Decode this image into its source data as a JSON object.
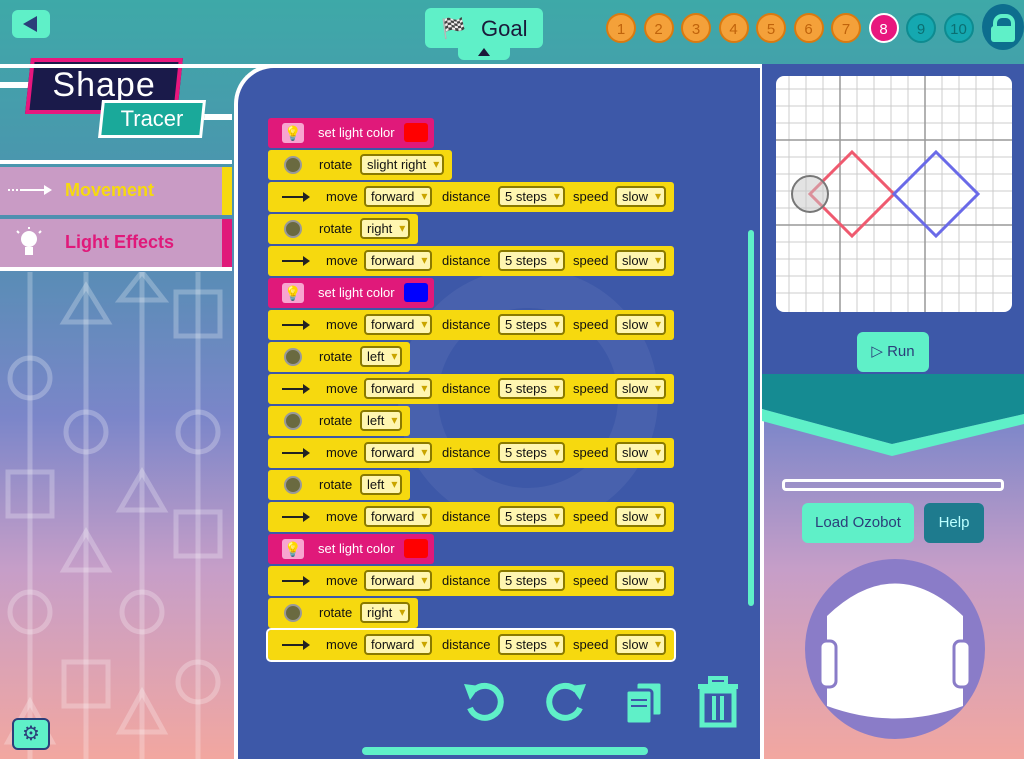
{
  "header": {
    "goal_label": "Goal",
    "levels": [
      {
        "n": "1",
        "state": "done"
      },
      {
        "n": "2",
        "state": "done"
      },
      {
        "n": "3",
        "state": "done"
      },
      {
        "n": "4",
        "state": "done"
      },
      {
        "n": "5",
        "state": "done"
      },
      {
        "n": "6",
        "state": "done"
      },
      {
        "n": "7",
        "state": "done"
      },
      {
        "n": "8",
        "state": "current"
      },
      {
        "n": "9",
        "state": "next"
      },
      {
        "n": "10",
        "state": "next"
      }
    ]
  },
  "logo": {
    "line1": "Shape",
    "line2": "Tracer"
  },
  "categories": [
    {
      "label": "Movement",
      "color": "#f6d90f",
      "icon": "arrow-icon"
    },
    {
      "label": "Light Effects",
      "color": "#e0197a",
      "icon": "lightbulb-icon"
    }
  ],
  "blocks": [
    {
      "type": "light",
      "label": "set light color",
      "color": "#ff0000"
    },
    {
      "type": "rotate",
      "label": "rotate",
      "value": "slight right"
    },
    {
      "type": "move",
      "label": "move",
      "dir": "forward",
      "dist_label": "distance",
      "dist": "5 steps",
      "speed_label": "speed",
      "speed": "slow"
    },
    {
      "type": "rotate",
      "label": "rotate",
      "value": "right"
    },
    {
      "type": "move",
      "label": "move",
      "dir": "forward",
      "dist_label": "distance",
      "dist": "5 steps",
      "speed_label": "speed",
      "speed": "slow"
    },
    {
      "type": "light",
      "label": "set light color",
      "color": "#0000ff"
    },
    {
      "type": "move",
      "label": "move",
      "dir": "forward",
      "dist_label": "distance",
      "dist": "5 steps",
      "speed_label": "speed",
      "speed": "slow"
    },
    {
      "type": "rotate",
      "label": "rotate",
      "value": "left"
    },
    {
      "type": "move",
      "label": "move",
      "dir": "forward",
      "dist_label": "distance",
      "dist": "5 steps",
      "speed_label": "speed",
      "speed": "slow"
    },
    {
      "type": "rotate",
      "label": "rotate",
      "value": "left"
    },
    {
      "type": "move",
      "label": "move",
      "dir": "forward",
      "dist_label": "distance",
      "dist": "5 steps",
      "speed_label": "speed",
      "speed": "slow"
    },
    {
      "type": "rotate",
      "label": "rotate",
      "value": "left"
    },
    {
      "type": "move",
      "label": "move",
      "dir": "forward",
      "dist_label": "distance",
      "dist": "5 steps",
      "speed_label": "speed",
      "speed": "slow"
    },
    {
      "type": "light",
      "label": "set light color",
      "color": "#ff0000"
    },
    {
      "type": "move",
      "label": "move",
      "dir": "forward",
      "dist_label": "distance",
      "dist": "5 steps",
      "speed_label": "speed",
      "speed": "slow"
    },
    {
      "type": "rotate",
      "label": "rotate",
      "value": "right"
    },
    {
      "type": "move",
      "label": "move",
      "dir": "forward",
      "dist_label": "distance",
      "dist": "5 steps",
      "speed_label": "speed",
      "speed": "slow"
    }
  ],
  "toolbar": {
    "undo_icon": "undo-icon",
    "redo_icon": "redo-icon",
    "cards_icon": "cards-icon",
    "trash_icon": "trash-icon"
  },
  "preview": {
    "run_label": "Run",
    "shape_colors": [
      "#ef5a6f",
      "#6a6ae8"
    ]
  },
  "actions": {
    "load_label": "Load Ozobot",
    "help_label": "Help"
  }
}
